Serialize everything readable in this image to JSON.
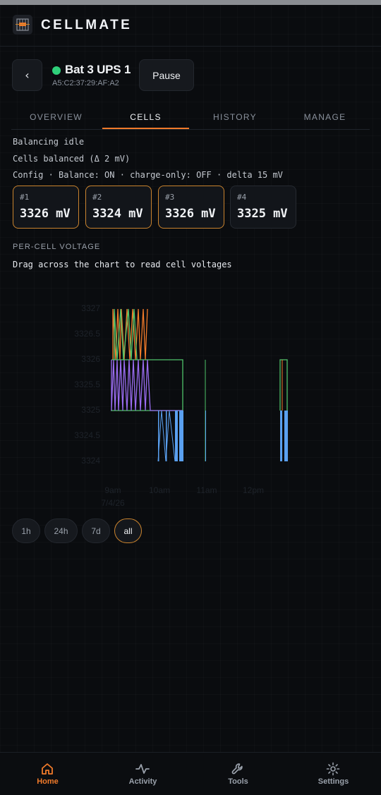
{
  "app": {
    "title": "CELLMATE",
    "logo_icon": "battery-grid-icon"
  },
  "device": {
    "name": "Bat 3 UPS 1",
    "mac": "A5:C2:37:29:AF:A2",
    "status_color": "#2fd07a",
    "back_label": "‹",
    "pause_label": "Pause"
  },
  "tabs": [
    {
      "label": "OVERVIEW",
      "active": false
    },
    {
      "label": "CELLS",
      "active": true
    },
    {
      "label": "HISTORY",
      "active": false
    },
    {
      "label": "MANAGE",
      "active": false
    }
  ],
  "status": {
    "balancing": "Balancing idle",
    "balanced": "Cells balanced (Δ 2 mV)",
    "config": "Config · Balance: ON · charge-only: OFF · delta 15 mV"
  },
  "cells": [
    {
      "index": "#1",
      "value": "3326 mV",
      "highlight": true
    },
    {
      "index": "#2",
      "value": "3324 mV",
      "highlight": true
    },
    {
      "index": "#3",
      "value": "3326 mV",
      "highlight": true
    },
    {
      "index": "#4",
      "value": "3325 mV",
      "highlight": false
    }
  ],
  "chart_section": {
    "heading": "PER-CELL VOLTAGE",
    "hint": "Drag across the chart to read cell voltages"
  },
  "chart_data": {
    "type": "line",
    "y_ticks": [
      "3327",
      "3326.5",
      "3326",
      "3325.5",
      "3325",
      "3324.5",
      "3324"
    ],
    "ylim": [
      3324,
      3327
    ],
    "x_ticks": [
      "9am",
      "10am",
      "11am",
      "12pm"
    ],
    "x_date_label": "7/4/26",
    "series": [
      {
        "color": "#f07a2a",
        "approx_range": [
          3326,
          3327
        ]
      },
      {
        "color": "#4fc36a",
        "approx_range": [
          3325,
          3327
        ]
      },
      {
        "color": "#9a6cf0",
        "approx_range": [
          3325,
          3326
        ]
      },
      {
        "color": "#5aa0f0",
        "approx_range": [
          3324,
          3326
        ]
      }
    ]
  },
  "ranges": [
    {
      "label": "1h",
      "active": false
    },
    {
      "label": "24h",
      "active": false
    },
    {
      "label": "7d",
      "active": false
    },
    {
      "label": "all",
      "active": true
    }
  ],
  "nav": [
    {
      "label": "Home",
      "icon": "home-icon",
      "active": true
    },
    {
      "label": "Activity",
      "icon": "activity-icon",
      "active": false
    },
    {
      "label": "Tools",
      "icon": "wrench-icon",
      "active": false
    },
    {
      "label": "Settings",
      "icon": "gear-icon",
      "active": false
    }
  ],
  "colors": {
    "accent": "#f07a2a",
    "background": "#0a0c0f",
    "status_ok": "#2fd07a"
  }
}
